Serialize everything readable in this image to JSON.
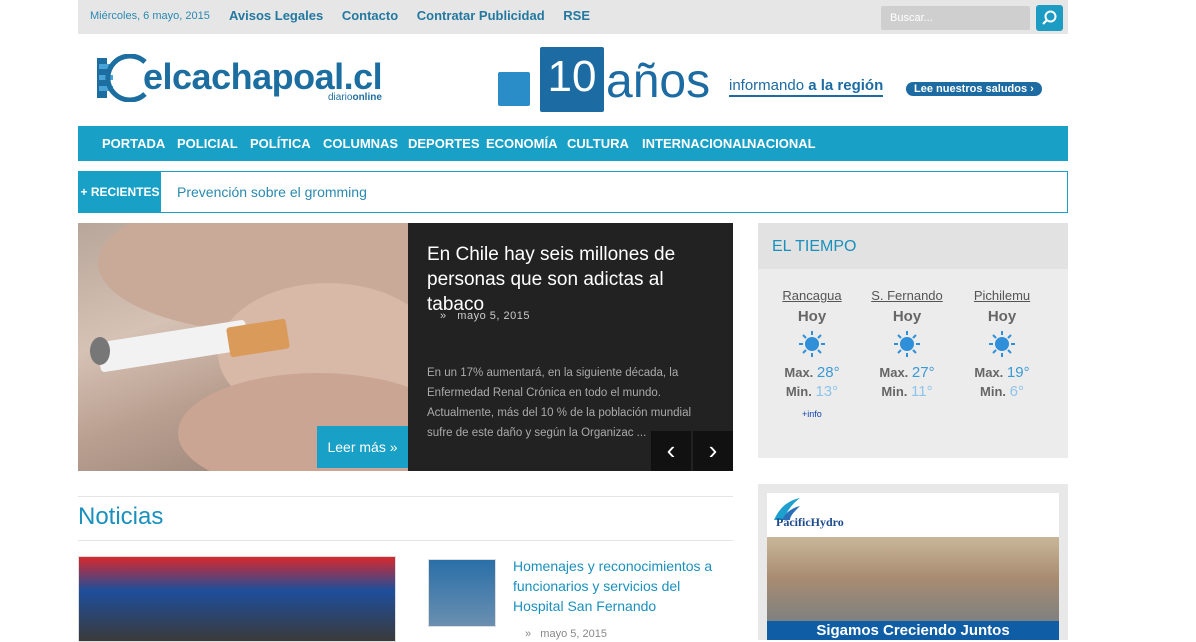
{
  "topbar": {
    "date": "Miércoles, 6 mayo, 2015",
    "links": [
      "Avisos Legales",
      "Contacto",
      "Contratar Publicidad",
      "RSE"
    ],
    "search_placeholder": "Buscar..."
  },
  "logo": {
    "name": "elcachapoal.cl",
    "sub_a": "diario",
    "sub_b": "online"
  },
  "anniversary": {
    "number": "10",
    "word": "años",
    "tag_a": "informando",
    "tag_b": "a la región",
    "button": "Lee nuestros saludos"
  },
  "nav": [
    "PORTADA",
    "POLICIAL",
    "POLÍTICA",
    "COLUMNAS",
    "DEPORTES",
    "ECONOMÍA",
    "CULTURA",
    "INTERNACIONAL",
    "NACIONAL"
  ],
  "recent": {
    "label": "+ RECIENTES",
    "headline": "Prevención sobre el gromming"
  },
  "slider": {
    "title": "En Chile hay seis millones de personas que son adictas al tabaco",
    "date": "mayo 5, 2015",
    "body": "En un 17% aumentará, en la siguiente década, la Enfermedad Renal Crónica en todo el mundo. Actualmente, más del 10 % de la población mundial sufre de este daño y según la Organizac ...",
    "read_more": "Leer más »",
    "prev": "‹",
    "next": "›"
  },
  "news": {
    "section_title": "Noticias",
    "item_title": "Homenajes y reconocimientos a funcionarios y servicios del Hospital San Fernando",
    "item_date": "mayo 5, 2015",
    "item_bullet": "»"
  },
  "weather": {
    "title": "EL TIEMPO",
    "cities": [
      {
        "city": "Rancagua",
        "day": "Hoy",
        "max": "28°",
        "min": "13°"
      },
      {
        "city": "S. Fernando",
        "day": "Hoy",
        "max": "27°",
        "min": "11°"
      },
      {
        "city": "Pichilemu",
        "day": "Hoy",
        "max": "19°",
        "min": "6°"
      }
    ],
    "max_label": "Max.",
    "min_label": "Min.",
    "more": "+info"
  },
  "ad": {
    "brand": "PacificHydro",
    "slogan": "Sigamos Creciendo Juntos"
  }
}
